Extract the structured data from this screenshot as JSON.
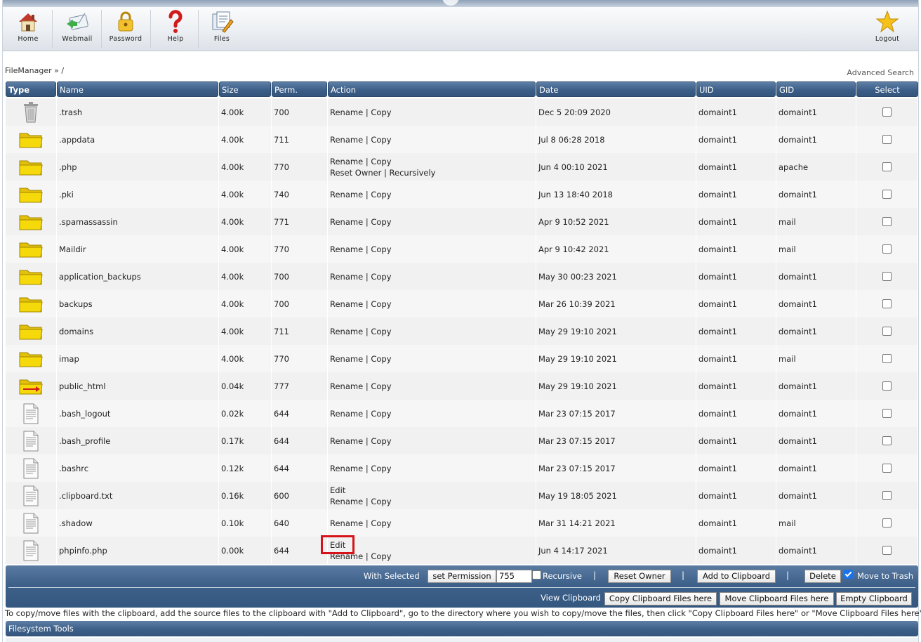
{
  "toolbar": {
    "items": [
      {
        "label": "Home",
        "icon": "home-icon"
      },
      {
        "label": "Webmail",
        "icon": "webmail-icon"
      },
      {
        "label": "Password",
        "icon": "padlock-icon"
      },
      {
        "label": "Help",
        "icon": "question-mark-icon"
      },
      {
        "label": "Files",
        "icon": "files-icon"
      }
    ],
    "logout": {
      "label": "Logout",
      "icon": "star-icon"
    }
  },
  "breadcrumb": "FileManager » /",
  "advanced_search": "Advanced Search",
  "table": {
    "headers": {
      "type": "Type",
      "name": "Name",
      "size": "Size",
      "perm": "Perm.",
      "action": "Action",
      "date": "Date",
      "uid": "UID",
      "gid": "GID",
      "select": "Select"
    },
    "sep": "|",
    "rows": [
      {
        "kind": "trash",
        "name": ".trash",
        "size": "4.00k",
        "perm": "700",
        "a1": "Rename",
        "a2": "Copy",
        "date": "Dec 5 20:09 2020",
        "uid": "domaint1",
        "gid": "domaint1"
      },
      {
        "kind": "folder",
        "name": ".appdata",
        "size": "4.00k",
        "perm": "711",
        "a1": "Rename",
        "a2": "Copy",
        "date": "Jul 8 06:28 2018",
        "uid": "domaint1",
        "gid": "domaint1"
      },
      {
        "kind": "folder",
        "name": ".php",
        "size": "4.00k",
        "perm": "770",
        "a1": "Rename",
        "a2": "Copy",
        "b1": "Reset Owner",
        "b2": "Recursively",
        "date": "Jun 4 00:10 2021",
        "uid": "domaint1",
        "gid": "apache"
      },
      {
        "kind": "folder",
        "name": ".pki",
        "size": "4.00k",
        "perm": "740",
        "a1": "Rename",
        "a2": "Copy",
        "date": "Jun 13 18:40 2018",
        "uid": "domaint1",
        "gid": "domaint1"
      },
      {
        "kind": "folder",
        "name": ".spamassassin",
        "size": "4.00k",
        "perm": "771",
        "a1": "Rename",
        "a2": "Copy",
        "date": "Apr 9 10:52 2021",
        "uid": "domaint1",
        "gid": "mail"
      },
      {
        "kind": "folder",
        "name": "Maildir",
        "size": "4.00k",
        "perm": "770",
        "a1": "Rename",
        "a2": "Copy",
        "date": "Apr 9 10:42 2021",
        "uid": "domaint1",
        "gid": "mail"
      },
      {
        "kind": "folder",
        "name": "application_backups",
        "size": "4.00k",
        "perm": "700",
        "a1": "Rename",
        "a2": "Copy",
        "date": "May 30 00:23 2021",
        "uid": "domaint1",
        "gid": "domaint1"
      },
      {
        "kind": "folder",
        "name": "backups",
        "size": "4.00k",
        "perm": "700",
        "a1": "Rename",
        "a2": "Copy",
        "date": "Mar 26 10:39 2021",
        "uid": "domaint1",
        "gid": "domaint1"
      },
      {
        "kind": "folder",
        "name": "domains",
        "size": "4.00k",
        "perm": "711",
        "a1": "Rename",
        "a2": "Copy",
        "date": "May 29 19:10 2021",
        "uid": "domaint1",
        "gid": "domaint1"
      },
      {
        "kind": "folder",
        "name": "imap",
        "size": "4.00k",
        "perm": "770",
        "a1": "Rename",
        "a2": "Copy",
        "date": "May 29 19:10 2021",
        "uid": "domaint1",
        "gid": "mail"
      },
      {
        "kind": "link",
        "name": "public_html",
        "size": "0.04k",
        "perm": "777",
        "a1": "Rename",
        "a2": "Copy",
        "date": "May 29 19:10 2021",
        "uid": "domaint1",
        "gid": "domaint1"
      },
      {
        "kind": "file",
        "name": ".bash_logout",
        "size": "0.02k",
        "perm": "644",
        "a1": "Rename",
        "a2": "Copy",
        "date": "Mar 23 07:15 2017",
        "uid": "domaint1",
        "gid": "domaint1"
      },
      {
        "kind": "file",
        "name": ".bash_profile",
        "size": "0.17k",
        "perm": "644",
        "a1": "Rename",
        "a2": "Copy",
        "date": "Mar 23 07:15 2017",
        "uid": "domaint1",
        "gid": "domaint1"
      },
      {
        "kind": "file",
        "name": ".bashrc",
        "size": "0.12k",
        "perm": "644",
        "a1": "Rename",
        "a2": "Copy",
        "date": "Mar 23 07:15 2017",
        "uid": "domaint1",
        "gid": "domaint1"
      },
      {
        "kind": "file",
        "name": ".clipboard.txt",
        "size": "0.16k",
        "perm": "600",
        "edit": "Edit",
        "a1": "Rename",
        "a2": "Copy",
        "date": "May 19 18:05 2021",
        "uid": "domaint1",
        "gid": "domaint1"
      },
      {
        "kind": "file",
        "name": ".shadow",
        "size": "0.10k",
        "perm": "640",
        "a1": "Rename",
        "a2": "Copy",
        "date": "Mar 31 14:21 2021",
        "uid": "domaint1",
        "gid": "mail"
      },
      {
        "kind": "file",
        "name": "phpinfo.php",
        "size": "0.00k",
        "perm": "644",
        "edit": "Edit",
        "a1": "Rename",
        "a2": "Copy",
        "date": "Jun 4 14:17 2021",
        "uid": "domaint1",
        "gid": "domaint1"
      }
    ]
  },
  "bottom": {
    "with_selected": "With Selected",
    "set_permission": "set Permission",
    "perm_value": "755",
    "recursive": "Recursive",
    "reset_owner": "Reset Owner",
    "add_to_clipboard": "Add to Clipboard",
    "delete": "Delete",
    "move_to_trash": "Move to Trash",
    "move_to_trash_checked": true,
    "view_clipboard": "View Clipboard",
    "copy_here": "Copy Clipboard Files here",
    "move_here": "Move Clipboard Files here",
    "empty": "Empty Clipboard",
    "pipe": "|"
  },
  "note": "To copy/move files with the clipboard, add the source files to the clipboard with \"Add to Clipboard\", go to the directory where you wish to copy/move the files, then click \"Copy Clipboard Files here\" or \"Move Clipboard Files here\"",
  "filesystem_tools": "Filesystem Tools",
  "colors": {
    "header_blue": "#3c5f88",
    "highlight_red": "#d6131a",
    "folder_yellow": "#f5d90a"
  }
}
